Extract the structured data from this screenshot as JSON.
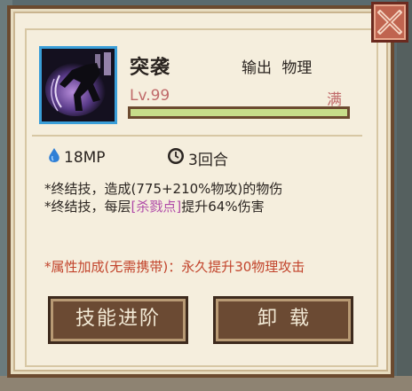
{
  "skill": {
    "name": "突袭",
    "tags": "输出 物理",
    "level_label": "Lv.99",
    "max_label": "满",
    "level_progress": 1.0
  },
  "stats": {
    "mp_cost": "18MP",
    "cooldown": "3回合"
  },
  "description": {
    "line1": "*终结技，造成(775+210%物攻)的物伤",
    "line2_prefix": "*终结技，每层",
    "line2_keyword": "[杀戮点]",
    "line2_suffix": "提升64%伤害"
  },
  "bonus_text": "*属性加成(无需携带)：永久提升30物理攻击",
  "buttons": {
    "upgrade_label": "技能进阶",
    "unload_label": "卸载"
  },
  "icons": {
    "mp": "water-drop-icon",
    "cooldown": "clock-icon",
    "close": "close-icon"
  },
  "colors": {
    "panel_bg": "#f5eedd",
    "border_brown": "#6b4a2f",
    "level_text": "#c06a6a",
    "keyword": "#b04aa8",
    "bonus": "#c2442c",
    "close_bg": "#c0644f",
    "icon_frame": "#3a9ed8",
    "bar_fill": "#c7dd8a"
  }
}
